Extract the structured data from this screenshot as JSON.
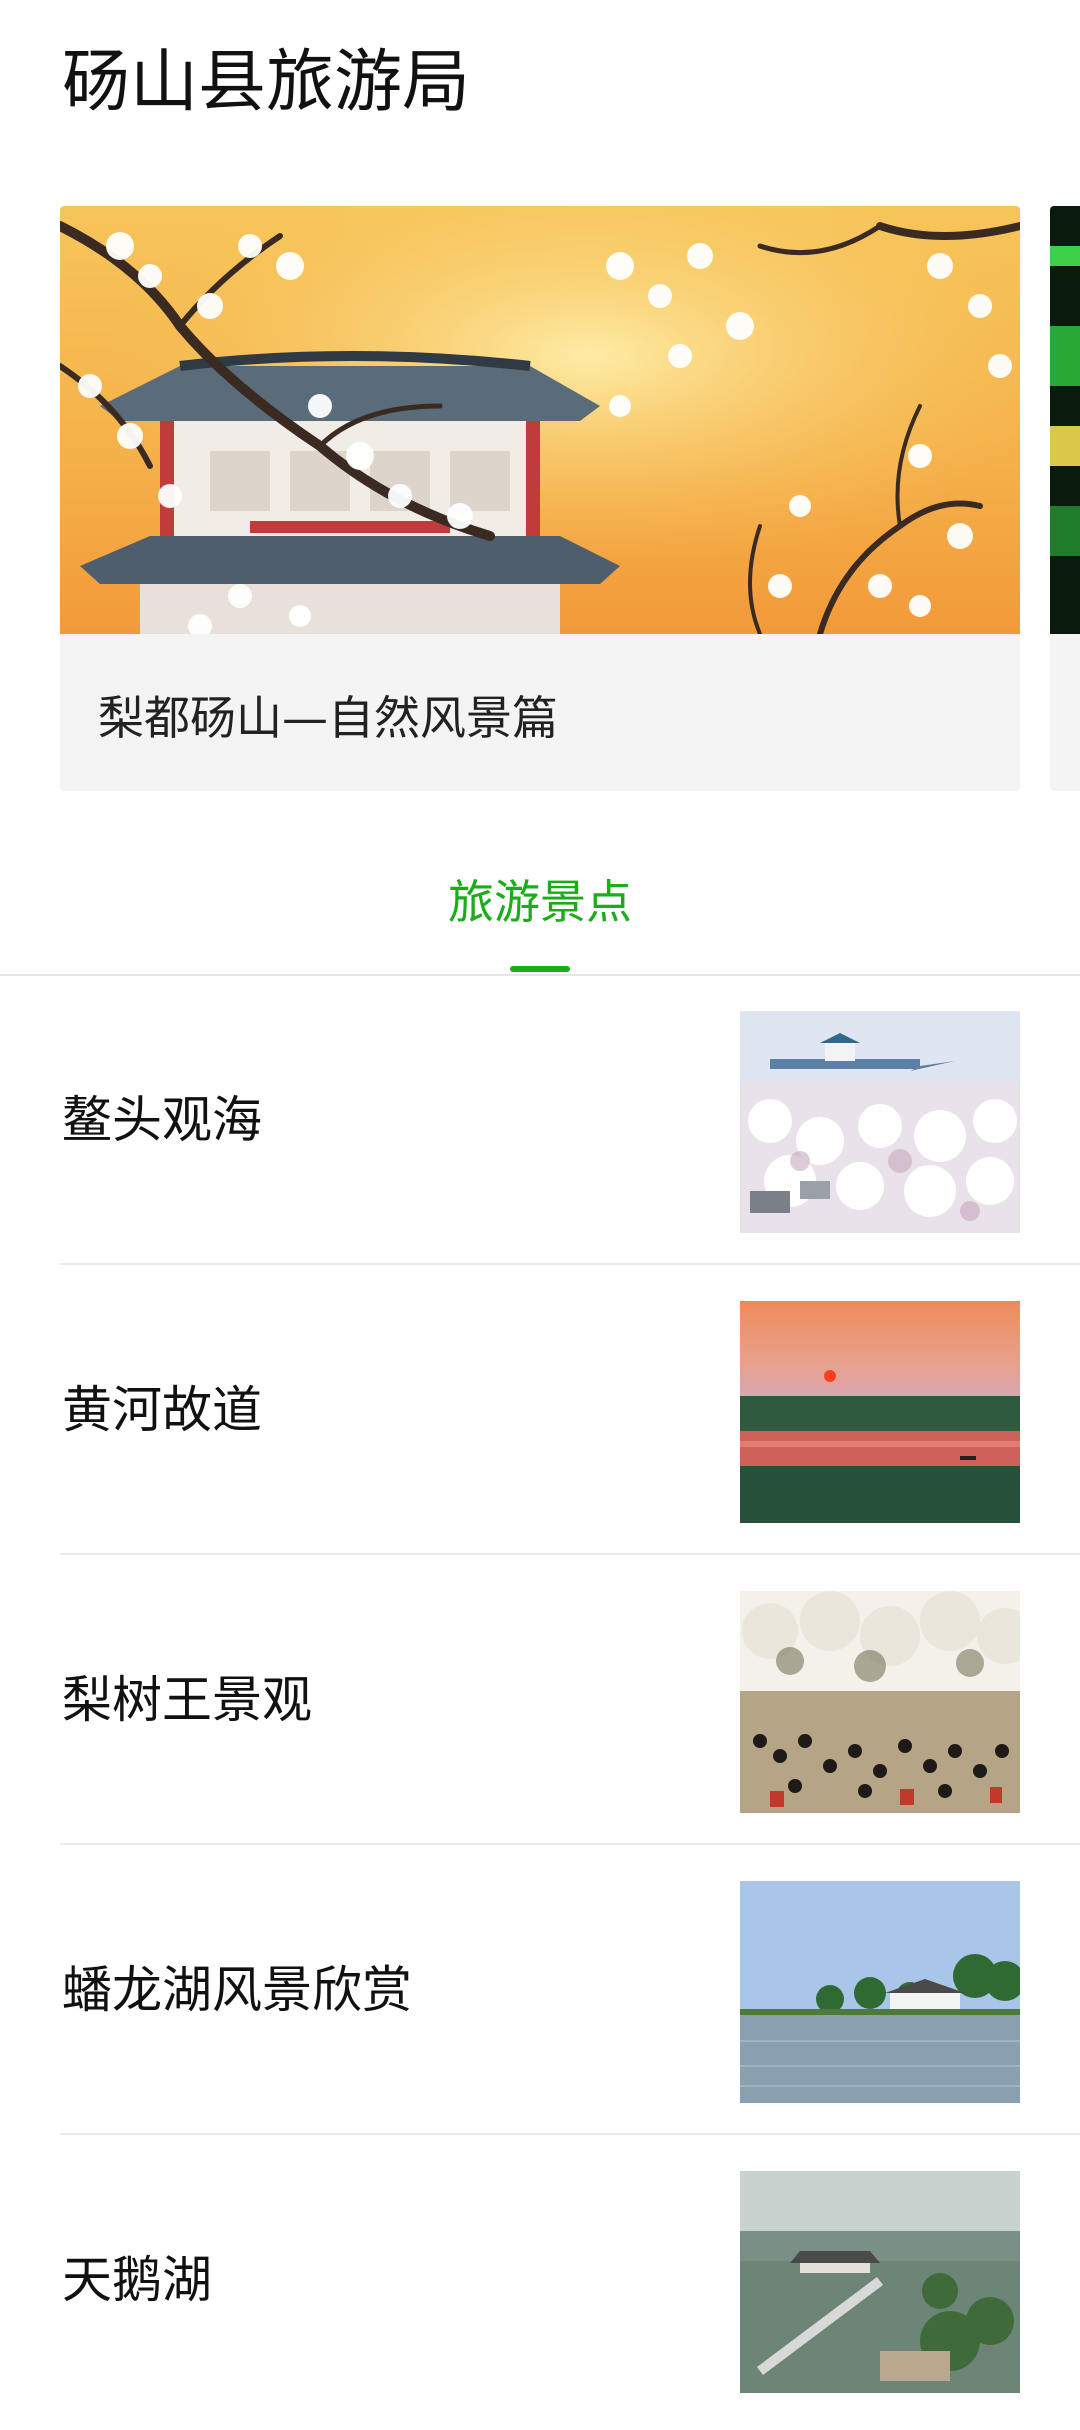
{
  "header": {
    "title": "砀山县旅游局"
  },
  "banner": {
    "cards": [
      {
        "caption": "梨都砀山—自然风景篇",
        "image": "pavilion-pear-blossom-sunset-photo"
      },
      {
        "caption": "",
        "image": "night-light-show-photo"
      }
    ]
  },
  "tabs": [
    {
      "label": "旅游景点",
      "active": true
    }
  ],
  "list": {
    "items": [
      {
        "title": "鳌头观海",
        "image": "pear-orchard-pavilion-photo"
      },
      {
        "title": "黄河故道",
        "image": "river-sunset-photo"
      },
      {
        "title": "梨树王景观",
        "image": "crowd-under-pear-trees-photo"
      },
      {
        "title": "蟠龙湖风景欣赏",
        "image": "lake-shore-house-photo"
      },
      {
        "title": "天鹅湖",
        "image": "lake-bridge-pavilion-photo"
      }
    ]
  },
  "colors": {
    "accent": "#1aad19",
    "divider": "#ebebeb",
    "card_bg": "#f4f4f4"
  }
}
